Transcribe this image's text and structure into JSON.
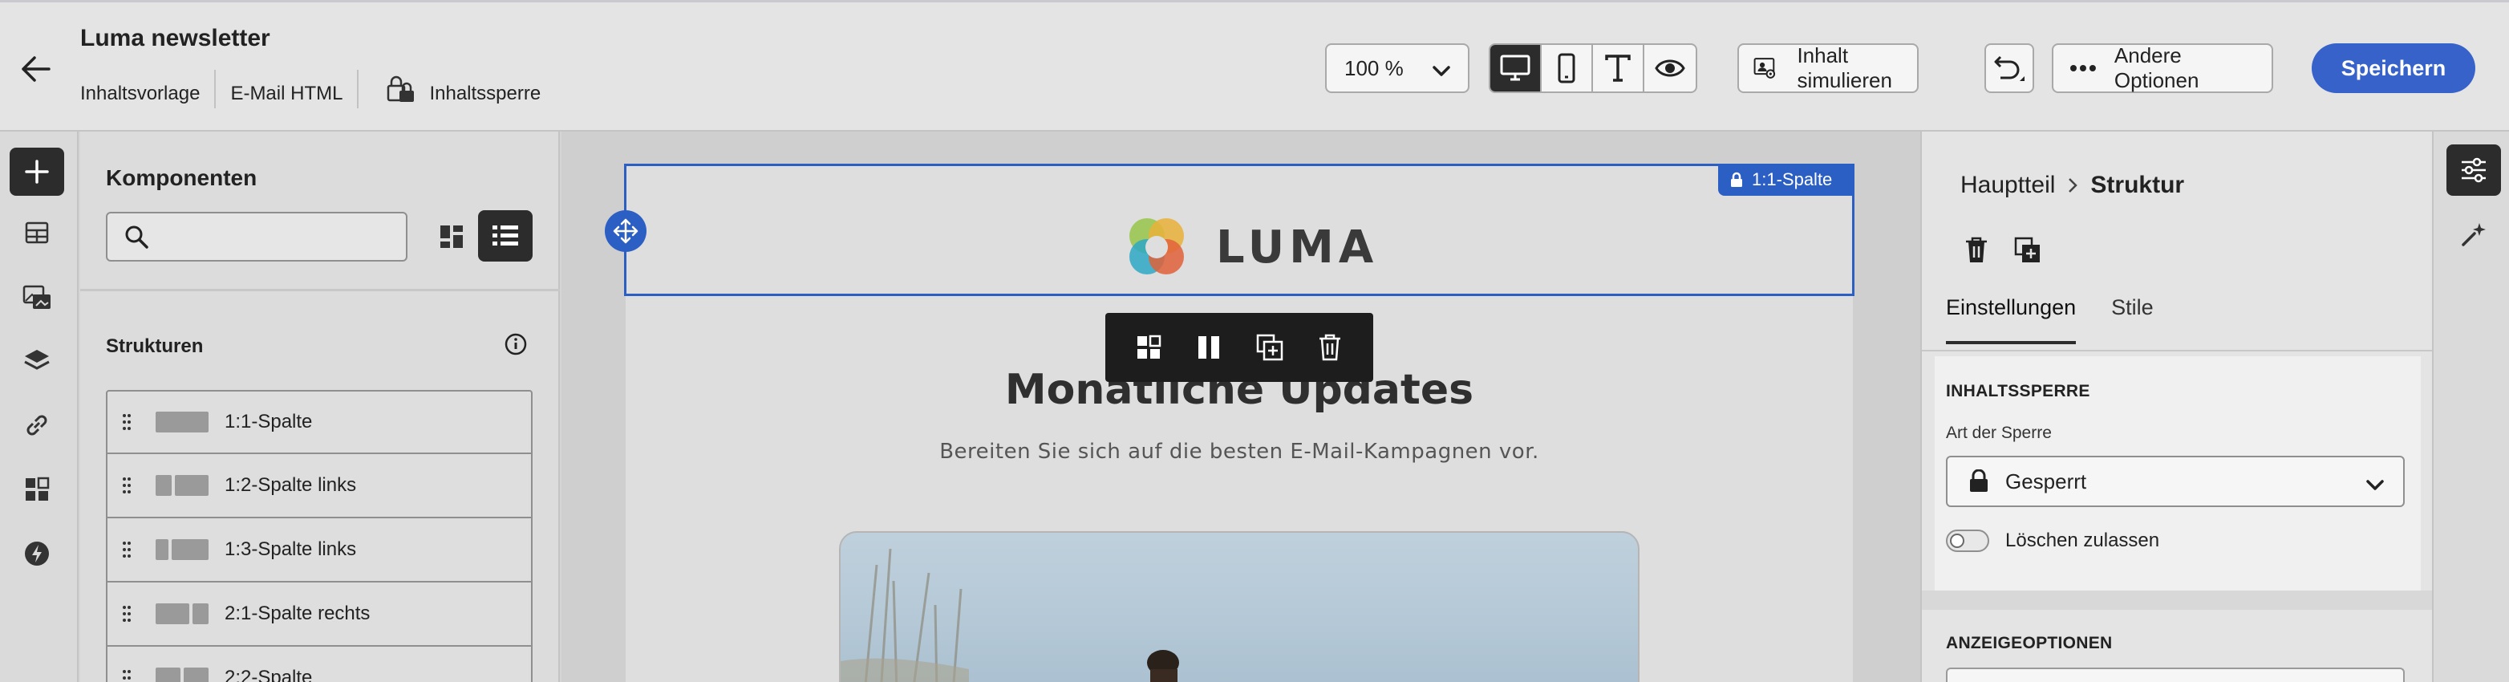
{
  "header": {
    "title": "Luma newsletter",
    "meta": {
      "content_template": "Inhaltsvorlage",
      "type": "E-Mail HTML",
      "lock": "Inhaltssperre"
    },
    "zoom": "100 %",
    "view_modes": [
      "desktop-icon",
      "mobile-icon",
      "text-icon",
      "preview-icon"
    ],
    "simulate_label": "Inhalt simulieren",
    "more_label": "Andere Optionen",
    "save_label": "Speichern"
  },
  "left_rail": {
    "icons": [
      "add-icon",
      "structure-icon",
      "assets-icon",
      "layers-icon",
      "link-icon",
      "fragments-icon",
      "lightning-icon"
    ]
  },
  "components": {
    "title": "Komponenten",
    "search_placeholder": "",
    "section_title": "Strukturen",
    "items": [
      {
        "label": "1:1-Spalte"
      },
      {
        "label": "1:2-Spalte links"
      },
      {
        "label": "1:3-Spalte links"
      },
      {
        "label": "2:1-Spalte rechts"
      },
      {
        "label": "2:2-Spalte"
      }
    ]
  },
  "canvas": {
    "selection_tag": "1:1-Spalte",
    "logo_text": "LUMA",
    "headline": "Monatliche Updates",
    "subline": "Bereiten Sie sich auf die besten E-Mail-Kampagnen vor."
  },
  "properties": {
    "breadcrumb": {
      "parent": "Hauptteil",
      "current": "Struktur"
    },
    "tabs": [
      "Einstellungen",
      "Stile"
    ],
    "lock_section": {
      "title": "INHALTSSPERRE",
      "field_label": "Art der Sperre",
      "selected": "Gesperrt",
      "toggle_label": "Löschen zulassen"
    },
    "display_section_title": "ANZEIGEOPTIONEN"
  },
  "colors": {
    "accent": "#3662c9",
    "selection": "#2c5fc4",
    "dark": "#2c2c2c"
  }
}
